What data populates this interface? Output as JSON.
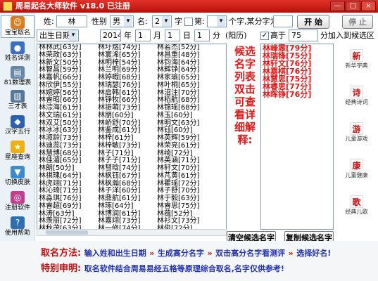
{
  "window": {
    "title": "周易起名大师软件 v18.0 已注册",
    "minimize": "—",
    "maximize": "□",
    "close": "×"
  },
  "colors": {
    "titlebar": "#c8150f",
    "accent_red": "#e01818",
    "info_blue": "#2030b0"
  },
  "sidebar": {
    "items": [
      {
        "label": "宝宝取名",
        "icon": "two-children-icon",
        "glyph": "☺",
        "color": "#e07b1a"
      },
      {
        "label": "姓名详测",
        "icon": "person-badge-icon",
        "glyph": "●",
        "color": "#3a6fc8"
      },
      {
        "label": "81数理表",
        "icon": "numbers-table-icon",
        "glyph": "▤",
        "color": "#6688aa"
      },
      {
        "label": "三才表",
        "icon": "three-talent-icon",
        "glyph": "▥",
        "color": "#557799"
      },
      {
        "label": "汉字五行",
        "icon": "five-elements-book-icon",
        "glyph": "◆",
        "color": "#2b5fb0"
      },
      {
        "label": "星座查询",
        "icon": "star-icon",
        "glyph": "★",
        "color": "#f0b010"
      },
      {
        "label": "切换皮肤",
        "icon": "skin-tshirt-icon",
        "glyph": "▼",
        "color": "#3c8ccc"
      },
      {
        "label": "注册软件",
        "icon": "register-cd-icon",
        "glyph": "◎",
        "color": "#c04090"
      },
      {
        "label": "使用帮助",
        "icon": "help-icon",
        "glyph": "?",
        "color": "#2d6fb0"
      }
    ]
  },
  "form": {
    "surname_label": "姓:",
    "surname_value": "林",
    "gender_label": "性别",
    "gender_value": "男",
    "name_label": "名:",
    "name_value": "2",
    "char_unit": "字",
    "fixed_label": "第:",
    "fixed_pos": "",
    "fixed_suffix": "个字,某分字为:",
    "fixed_char": "",
    "start_button": "开 始",
    "stop_button": "停 止",
    "date_type": "出生日期",
    "year": "2014",
    "year_unit": "年",
    "month": "1",
    "month_unit": "月",
    "day": "1",
    "day_unit": "日",
    "hour": "1",
    "hour_unit": "分",
    "calendar_note": "(阳历)",
    "min_score_label": "高于",
    "min_score_value": "75",
    "min_score_suffix": "分加入到候选区",
    "min_score_checked": "✓"
  },
  "name_columns": [
    [
      "林林武[63分]",
      "林荣政[63分]",
      "林新文[50分]",
      "林智昌[59分]",
      "林嘉帆[66分]",
      "林欣伊[55分]",
      "林婉婷[56分]",
      "林睿昭[66分]",
      "林淙海[61分]",
      "林文瑞[61分]",
      "林双艾[50分]",
      "林冰冰[63分]",
      "林淑龄[73分]",
      "林迪蕊[73分]",
      "林慧博[68分]",
      "林佳湄[65分]",
      "林朗[50分]",
      "林祺瑰[64分]",
      "林虎翊[71分]",
      "林沁琦[71分]",
      "林淼琪[76分]",
      "林睿超[69分]",
      "林涛[63分]",
      "林羡丽[72分]",
      "林秋茂[63分]",
      "林苗[73分]",
      "林振宏[73分]",
      "林东[72分]"
    ],
    [
      "林圩煜[74分]",
      "林寰浠[65分]",
      "林明梓[54分]",
      "林兰明[69分]",
      "林婷暇[68分]",
      "林瑞瑟[76分]",
      "林启韩[61分]",
      "林铮牧[66分]",
      "林振萌[73分]",
      "林朋[60分]",
      "林峤舒[70分]",
      "林鉴成[61分]",
      "林梓[61分]",
      "林梓敏[73分]",
      "林子[71分]",
      "林子子[71分]",
      "林彗晗[74分]",
      "林枫钰[67分]",
      "林枫瀚[68分]",
      "林子洋[60分]",
      "林鼎航[61分]",
      "林琢[64分]",
      "林博润[61分]",
      "林嘉翊[73分]",
      "林一修[74分]",
      "林博雪[74分]",
      "林杰煜[71分]",
      "林霖芈[74分]",
      "林泊水[71分]"
    ],
    [
      "林若杰[52分]",
      "林昌重[48分]",
      "林钧海[64分]",
      "林辉铮[64分]",
      "林家瑜[65分]",
      "林叶桐[65分]",
      "林沼注[70分]",
      "林稻航[68分]",
      "林锦瑶[68分]",
      "林玉[60分]",
      "林明文[63分]",
      "林钰[60分]",
      "林英辉[59分]",
      "林荣亮[61分]",
      "林绮[72分]",
      "林英涵[71分]",
      "林轩文[70分]",
      "林芃黄[61分]",
      "林瞿瑶[72分]",
      "林子舒[70分]",
      "林于毅[63分]",
      "林睿思[75分]",
      "林蕴[52分]",
      "林衫文[73分]",
      "林俊[72分]",
      "林木天[72分]",
      "林子新[69分]",
      "林源[63分]"
    ]
  ],
  "hint_text": "候选名字列表双击可查看详细解释:",
  "selected_names": [
    "林峰霏[79分]",
    "林瑞锋[75分]",
    "林轩文[76分]",
    "林嘉棋[76分]",
    "林慧思[75分]",
    "林睿思[77分]",
    "林晖铮[76分]"
  ],
  "right_tools": [
    {
      "label": "新华字典",
      "icon": "dictionary-icon",
      "glyph": "新"
    },
    {
      "label": "经典诗词",
      "icon": "poetry-icon",
      "glyph": "诗"
    },
    {
      "label": "儿童游戏",
      "icon": "kids-game-icon",
      "glyph": "游"
    },
    {
      "label": "儿童健康",
      "icon": "kids-health-icon",
      "glyph": "康"
    },
    {
      "label": "经典儿歌",
      "icon": "kids-song-icon",
      "glyph": "歌"
    }
  ],
  "buttons": {
    "clear_candidates": "清空候选名字",
    "copy_candidates": "复制候选名字"
  },
  "footer": {
    "method_label": "取名方法:",
    "method_steps": [
      "输入姓和出生日期",
      "生成高分名字",
      "双击高分名字看测评",
      "选择好名!"
    ],
    "notice_label": "特别申明:",
    "notice_text": "取名软件结合周易易经五格等原理综合取名,名字仅供参考!"
  }
}
